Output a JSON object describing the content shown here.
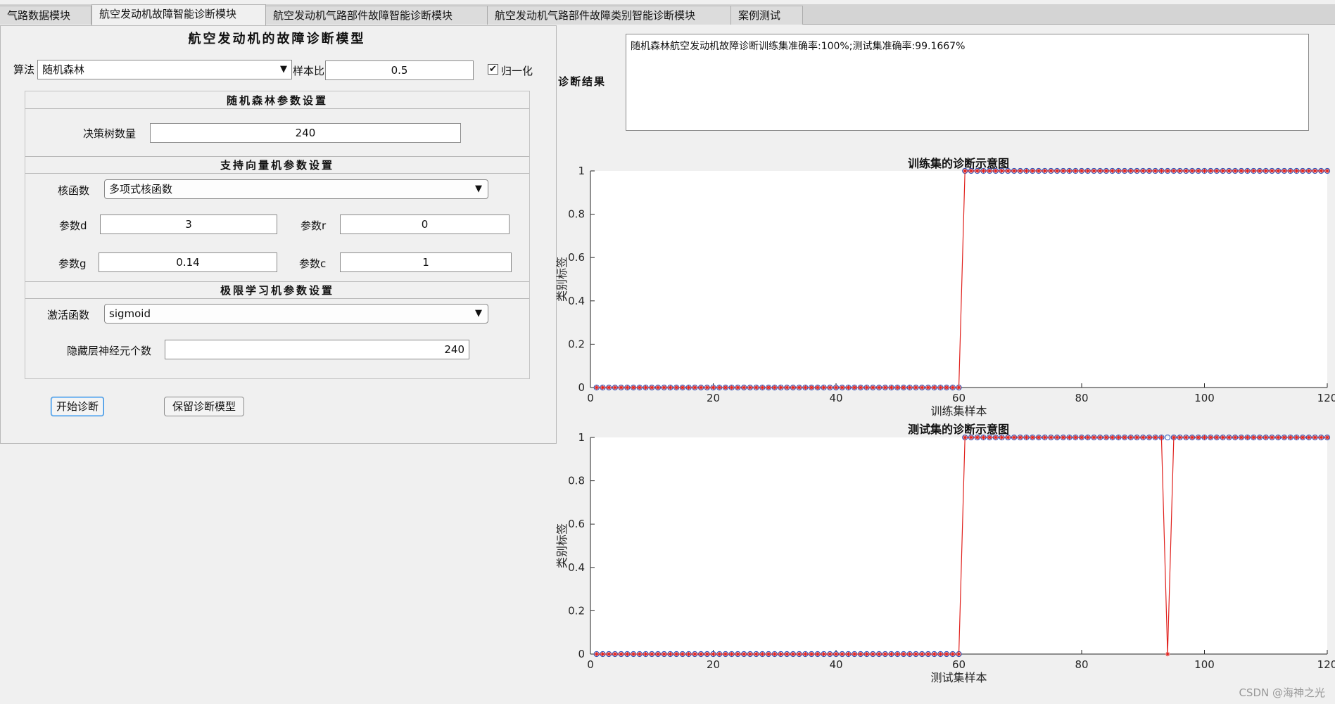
{
  "tabs": [
    "气路数据模块",
    "航空发动机故障智能诊断模块",
    "航空发动机气路部件故障智能诊断模块",
    "航空发动机气路部件故障类别智能诊断模块",
    "案例测试"
  ],
  "active_tab": 1,
  "panel_title": "航空发动机的故障诊断模型",
  "algorithm": {
    "label": "算法",
    "value": "随机森林"
  },
  "sample_ratio": {
    "label": "样本比",
    "value": "0.5"
  },
  "normalize": {
    "label": "归一化",
    "checked": true
  },
  "rf": {
    "title": "随机森林参数设置",
    "trees_label": "决策树数量",
    "trees_value": "240"
  },
  "svm": {
    "title": "支持向量机参数设置",
    "kernel_label": "核函数",
    "kernel_value": "多项式核函数",
    "d_label": "参数d",
    "d_value": "3",
    "r_label": "参数r",
    "r_value": "0",
    "g_label": "参数g",
    "g_value": "0.14",
    "c_label": "参数c",
    "c_value": "1"
  },
  "elm": {
    "title": "极限学习机参数设置",
    "activation_label": "激活函数",
    "activation_value": "sigmoid",
    "hidden_label": "隐藏层神经元个数",
    "hidden_value": "240"
  },
  "buttons": {
    "start": "开始诊断",
    "save": "保留诊断模型"
  },
  "result": {
    "label": "诊断结果",
    "text": "随机森林航空发动机故障诊断训练集准确率:100%;测试集准确率:99.1667%"
  },
  "colors": {
    "true_marker": "#1f4fbf",
    "pred_marker": "#e0201c",
    "pred_line": "#e0201c"
  },
  "chart_data": [
    {
      "type": "line",
      "title": "训练集的诊断示意图",
      "xlabel": "训练集样本",
      "ylabel": "类别标签",
      "xlim": [
        0,
        120
      ],
      "ylim": [
        0,
        1
      ],
      "xticks": [
        0,
        20,
        40,
        60,
        80,
        100,
        120
      ],
      "yticks": [
        0,
        0.2,
        0.4,
        0.6,
        0.8,
        1
      ],
      "n": 120,
      "series": [
        {
          "marker": "circle",
          "segments": [
            {
              "from": 1,
              "to": 60,
              "y": 0
            },
            {
              "from": 61,
              "to": 120,
              "y": 1
            }
          ]
        },
        {
          "marker": "asterisk",
          "segments": [
            {
              "from": 1,
              "to": 60,
              "y": 0
            },
            {
              "from": 61,
              "to": 120,
              "y": 1
            }
          ]
        }
      ]
    },
    {
      "type": "line",
      "title": "测试集的诊断示意图",
      "xlabel": "测试集样本",
      "ylabel": "类别标签",
      "xlim": [
        0,
        120
      ],
      "ylim": [
        0,
        1
      ],
      "xticks": [
        0,
        20,
        40,
        60,
        80,
        100,
        120
      ],
      "yticks": [
        0,
        0.2,
        0.4,
        0.6,
        0.8,
        1
      ],
      "n": 120,
      "series": [
        {
          "marker": "circle",
          "segments": [
            {
              "from": 1,
              "to": 60,
              "y": 0
            },
            {
              "from": 61,
              "to": 120,
              "y": 1
            }
          ]
        },
        {
          "marker": "asterisk",
          "segments": [
            {
              "from": 1,
              "to": 60,
              "y": 0
            },
            {
              "from": 61,
              "to": 93,
              "y": 1
            },
            {
              "from": 94,
              "to": 94,
              "y": 0
            },
            {
              "from": 95,
              "to": 120,
              "y": 1
            }
          ]
        }
      ]
    }
  ],
  "watermark": "CSDN @海神之光"
}
